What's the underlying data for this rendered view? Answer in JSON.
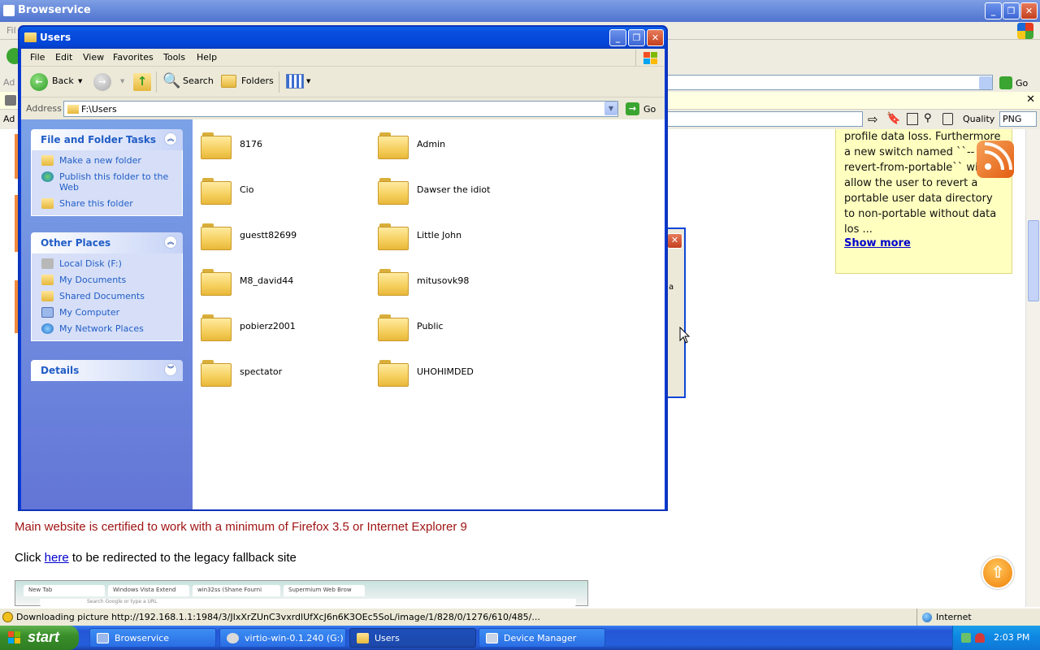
{
  "browser": {
    "title": "Browservice",
    "menu_partial": "Fil",
    "addr_partial": "Ad",
    "go_label": "Go",
    "quality_label": "Quality",
    "format_value": "PNG",
    "status_message": "Downloading picture http://192.168.1.1:1984/3/JIxXrZUnC3vxrdlUfXcJ6n6K3OEc5SoL/image/1/828/0/1276/610/485/...",
    "zone": "Internet"
  },
  "page": {
    "sidebar_text": "profile data loss. Furthermore a new switch named ``--revert-from-portable`` will allow the user to revert a portable user data directory to non-portable without data los ...",
    "show_more": "Show more",
    "cert_message": "Main website is certified to work with a minimum of Firefox 3.5 or Internet Explorer 9",
    "click_prefix": "Click",
    "click_link": "here",
    "click_suffix": "to be redirected to the legacy fallback site",
    "embedded_tabs": [
      "New Tab",
      "Windows Vista Extend",
      "win32ss (Shane Fourni",
      "Supermium Web Brow"
    ],
    "embedded_search": "Search Google or type a URL",
    "dialog_partial_text": "a"
  },
  "explorer": {
    "title": "Users",
    "menu": [
      "File",
      "Edit",
      "View",
      "Favorites",
      "Tools",
      "Help"
    ],
    "toolbar": {
      "back": "Back",
      "search": "Search",
      "folders": "Folders"
    },
    "address_label": "Address",
    "address_value": "F:\\Users",
    "go_label": "Go",
    "tasks": {
      "title": "File and Folder Tasks",
      "items": [
        "Make a new folder",
        "Publish this folder to the Web",
        "Share this folder"
      ]
    },
    "other_places": {
      "title": "Other Places",
      "items": [
        "Local Disk (F:)",
        "My Documents",
        "Shared Documents",
        "My Computer",
        "My Network Places"
      ]
    },
    "details": {
      "title": "Details"
    },
    "folders": [
      "8176",
      "Admin",
      "Cio",
      "Dawser the idiot",
      "guestt82699",
      "Little John",
      "M8_david44",
      "mitusovk98",
      "pobierz2001",
      "Public",
      "spectator",
      "UHOHIMDED"
    ]
  },
  "taskbar": {
    "start": "start",
    "tasks": [
      "Browservice",
      "virtio-win-0.1.240 (G:)",
      "Users",
      "Device Manager"
    ],
    "time": "2:03 PM"
  },
  "colors": {
    "xp_blue": "#0a3bd6",
    "taskpane_link": "#215dc6",
    "cert_red": "#a01414"
  }
}
